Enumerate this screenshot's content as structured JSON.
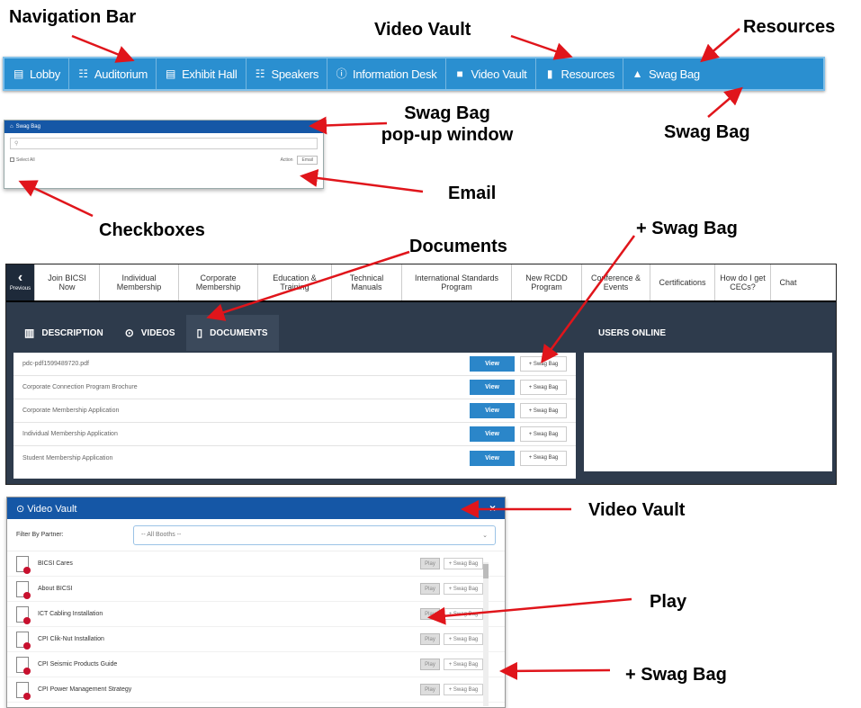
{
  "callouts": {
    "navigation_bar": "Navigation Bar",
    "video_vault_top": "Video Vault",
    "resources": "Resources",
    "swag_bag_nav": "Swag Bag",
    "swag_popup_line1": "Swag Bag",
    "swag_popup_line2": "pop-up window",
    "email": "Email",
    "checkboxes": "Checkboxes",
    "documents": "Documents",
    "plus_swag_bag_top": "+ Swag Bag",
    "video_vault_bottom": "Video Vault",
    "play": "Play",
    "plus_swag_bag_bottom": "+ Swag Bag"
  },
  "navbar": {
    "items": [
      {
        "label": "Lobby",
        "icon": "building-icon"
      },
      {
        "label": "Auditorium",
        "icon": "grid-icon"
      },
      {
        "label": "Exhibit Hall",
        "icon": "building-icon"
      },
      {
        "label": "Speakers",
        "icon": "grid-icon"
      },
      {
        "label": "Information Desk",
        "icon": "info-icon"
      },
      {
        "label": "Video Vault",
        "icon": "video-camera-icon"
      },
      {
        "label": "Resources",
        "icon": "book-icon"
      },
      {
        "label": "Swag Bag",
        "icon": "bag-icon"
      }
    ]
  },
  "swag_popup": {
    "title": "Swag Bag",
    "select_all": "Select All",
    "action_label": "Action",
    "email_button": "Email"
  },
  "booth": {
    "previous": "Previous",
    "tabs": [
      "Join BICSI Now",
      "Individual Membership",
      "Corporate Membership",
      "Education & Training",
      "Technical Manuals",
      "International Standards Program",
      "New RCDD Program",
      "Conference & Events",
      "Certifications",
      "How do I get CECs?",
      "Chat"
    ],
    "sub_tabs": [
      "DESCRIPTION",
      "VIDEOS",
      "DOCUMENTS"
    ],
    "users_online": "USERS ONLINE",
    "view_label": "View",
    "swag_label": "+ Swag Bag",
    "documents": [
      "pdc-pdf1599489720.pdf",
      "Corporate Connection Program Brochure",
      "Corporate Membership Application",
      "Individual Membership Application",
      "Student Membership Application"
    ]
  },
  "vault": {
    "title": "Video Vault",
    "close": "×",
    "filter_label": "Filter By Partner:",
    "filter_value": "-- All Booths --",
    "play_label": "Play",
    "swag_label": "+ Swag Bag",
    "videos": [
      "BICSI Cares",
      "About BICSI",
      "ICT Cabling Installation",
      "CPI Clik-Nut Installation",
      "CPI Seismic Products Guide",
      "CPI Power Management Strategy"
    ]
  },
  "colors": {
    "nav_blue": "#2a8fd0",
    "header_blue": "#1557a6",
    "dark_panel": "#2e3b4c",
    "arrow_red": "#e0151b"
  }
}
